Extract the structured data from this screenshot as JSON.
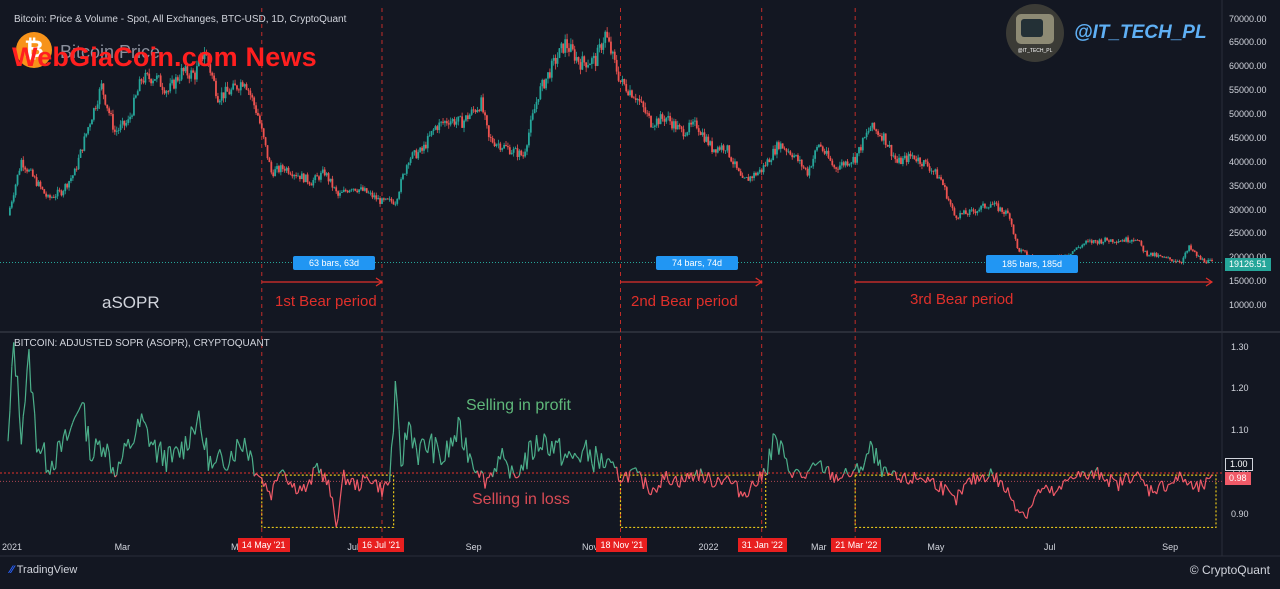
{
  "header": {
    "price_title": "Bitcoin: Price & Volume - Spot, All Exchanges, BTC-USD, 1D, CryptoQuant",
    "sopr_title": "BITCOIN: ADJUSTED SOPR (ASOPR), CRYPTOQUANT",
    "ghost_label": "Bitcoin Price",
    "watermark": "WebGiaCoin.com News",
    "handle": "@IT_TECH_PL",
    "avatar_caption": "@IT_TECH_PL"
  },
  "footer": {
    "tradingview": "TradingView",
    "cryptoquant": "CryptoQuant"
  },
  "annotations": {
    "asopr": "aSOPR",
    "bear1": "1st Bear period",
    "bear2": "2nd Bear period",
    "bear3": "3rd Bear period",
    "profit": "Selling in profit",
    "loss": "Selling in loss",
    "badge1": "63 bars, 63d",
    "badge2": "74 bars, 74d",
    "badge3": "185 bars, 185d"
  },
  "colors": {
    "background": "#131722",
    "up": "#26a69a",
    "down": "#ef5350",
    "profit_line": "#4caf8a",
    "loss_line": "#f05a68",
    "annotation_red": "#e0302b",
    "highlight_box": "#e6c619"
  },
  "chart_data": [
    {
      "type": "candlestick",
      "title": "Bitcoin: Price & Volume - Spot, All Exchanges, BTC-USD, 1D, CryptoQuant",
      "ylim": [
        5000,
        72000
      ],
      "y_ticks": [
        "70000.00",
        "65000.00",
        "60000.00",
        "55000.00",
        "50000.00",
        "45000.00",
        "40000.00",
        "35000.00",
        "30000.00",
        "25000.00",
        "20000.00",
        "15000.00",
        "10000.00"
      ],
      "last_price": "19126.51",
      "x_ticks": [
        "2021",
        "Mar",
        "May",
        "Jul",
        "Sep",
        "Nov",
        "2022",
        "Mar",
        "May",
        "Jul",
        "Sep"
      ],
      "series": [
        {
          "points": [
            [
              "2021-01-01",
              29000
            ],
            [
              "2021-01-08",
              40500
            ],
            [
              "2021-01-15",
              36500
            ],
            [
              "2021-01-22",
              32500
            ],
            [
              "2021-01-29",
              34000
            ],
            [
              "2021-02-05",
              38000
            ],
            [
              "2021-02-12",
              47500
            ],
            [
              "2021-02-19",
              56000
            ],
            [
              "2021-02-26",
              46500
            ],
            [
              "2021-03-05",
              48500
            ],
            [
              "2021-03-12",
              57500
            ],
            [
              "2021-03-19",
              58000
            ],
            [
              "2021-03-26",
              55000
            ],
            [
              "2021-04-02",
              59000
            ],
            [
              "2021-04-09",
              58500
            ],
            [
              "2021-04-14",
              63500
            ],
            [
              "2021-04-21",
              54000
            ],
            [
              "2021-04-28",
              55000
            ],
            [
              "2021-05-05",
              57500
            ],
            [
              "2021-05-12",
              50000
            ],
            [
              "2021-05-19",
              38000
            ],
            [
              "2021-05-26",
              39000
            ],
            [
              "2021-06-02",
              37500
            ],
            [
              "2021-06-09",
              36000
            ],
            [
              "2021-06-16",
              38000
            ],
            [
              "2021-06-23",
              33000
            ],
            [
              "2021-06-30",
              35000
            ],
            [
              "2021-07-07",
              34000
            ],
            [
              "2021-07-16",
              31800
            ],
            [
              "2021-07-23",
              32000
            ],
            [
              "2021-07-30",
              41000
            ],
            [
              "2021-08-06",
              42500
            ],
            [
              "2021-08-13",
              47500
            ],
            [
              "2021-08-20",
              49000
            ],
            [
              "2021-08-27",
              48500
            ],
            [
              "2021-09-06",
              52500
            ],
            [
              "2021-09-10",
              45000
            ],
            [
              "2021-09-20",
              43000
            ],
            [
              "2021-09-28",
              41500
            ],
            [
              "2021-10-06",
              54500
            ],
            [
              "2021-10-15",
              61500
            ],
            [
              "2021-10-20",
              65000
            ],
            [
              "2021-10-28",
              61000
            ],
            [
              "2021-11-05",
              61500
            ],
            [
              "2021-11-10",
              67000
            ],
            [
              "2021-11-18",
              57000
            ],
            [
              "2021-11-26",
              54000
            ],
            [
              "2021-12-04",
              48500
            ],
            [
              "2021-12-12",
              49500
            ],
            [
              "2021-12-20",
              46500
            ],
            [
              "2021-12-28",
              48000
            ],
            [
              "2022-01-05",
              43000
            ],
            [
              "2022-01-12",
              43500
            ],
            [
              "2022-01-21",
              36000
            ],
            [
              "2022-01-31",
              38500
            ],
            [
              "2022-02-09",
              44000
            ],
            [
              "2022-02-16",
              42000
            ],
            [
              "2022-02-24",
              38000
            ],
            [
              "2022-03-02",
              44000
            ],
            [
              "2022-03-10",
              39000
            ],
            [
              "2022-03-21",
              41000
            ],
            [
              "2022-03-29",
              47500
            ],
            [
              "2022-04-05",
              45500
            ],
            [
              "2022-04-12",
              40000
            ],
            [
              "2022-04-20",
              41500
            ],
            [
              "2022-04-28",
              39500
            ],
            [
              "2022-05-05",
              36500
            ],
            [
              "2022-05-12",
              29000
            ],
            [
              "2022-05-20",
              29500
            ],
            [
              "2022-05-31",
              31500
            ],
            [
              "2022-06-10",
              29000
            ],
            [
              "2022-06-14",
              22000
            ],
            [
              "2022-06-20",
              20500
            ],
            [
              "2022-06-30",
              19500
            ],
            [
              "2022-07-10",
              20800
            ],
            [
              "2022-07-20",
              23300
            ],
            [
              "2022-07-30",
              23800
            ],
            [
              "2022-08-10",
              23900
            ],
            [
              "2022-08-15",
              24300
            ],
            [
              "2022-08-20",
              21200
            ],
            [
              "2022-08-30",
              20000
            ],
            [
              "2022-09-08",
              19400
            ],
            [
              "2022-09-12",
              22200
            ],
            [
              "2022-09-18",
              19800
            ],
            [
              "2022-09-24",
              19126.51
            ]
          ]
        }
      ],
      "markers": [
        {
          "date": "14 May '21"
        },
        {
          "date": "16 Jul '21"
        },
        {
          "date": "18 Nov '21"
        },
        {
          "date": "31 Jan '22"
        },
        {
          "date": "21 Mar '22"
        }
      ]
    },
    {
      "type": "line",
      "title": "BITCOIN: ADJUSTED SOPR (ASOPR), CRYPTOQUANT",
      "ylim": [
        0.84,
        1.33
      ],
      "y_ticks": [
        "1.30",
        "1.20",
        "1.10",
        "1.00",
        "0.90"
      ],
      "reference_value": "1.00",
      "last_value": "0.98",
      "series": [
        {
          "points": [
            [
              "2021-01-01",
              1.06
            ],
            [
              "2021-01-04",
              1.31
            ],
            [
              "2021-01-08",
              1.1
            ],
            [
              "2021-01-12",
              1.27
            ],
            [
              "2021-01-16",
              1.08
            ],
            [
              "2021-01-22",
              1.02
            ],
            [
              "2021-01-28",
              1.05
            ],
            [
              "2021-02-03",
              1.1
            ],
            [
              "2021-02-08",
              1.18
            ],
            [
              "2021-02-14",
              1.04
            ],
            [
              "2021-02-20",
              1.08
            ],
            [
              "2021-02-26",
              1.0
            ],
            [
              "2021-03-05",
              1.06
            ],
            [
              "2021-03-12",
              1.12
            ],
            [
              "2021-03-20",
              1.05
            ],
            [
              "2021-03-28",
              1.03
            ],
            [
              "2021-04-04",
              1.07
            ],
            [
              "2021-04-10",
              1.13
            ],
            [
              "2021-04-18",
              1.01
            ],
            [
              "2021-04-26",
              1.04
            ],
            [
              "2021-05-05",
              1.08
            ],
            [
              "2021-05-12",
              1.0
            ],
            [
              "2021-05-19",
              0.95
            ],
            [
              "2021-05-24",
              1.02
            ],
            [
              "2021-05-30",
              0.97
            ],
            [
              "2021-06-07",
              0.96
            ],
            [
              "2021-06-12",
              1.02
            ],
            [
              "2021-06-18",
              0.97
            ],
            [
              "2021-06-22",
              0.88
            ],
            [
              "2021-06-26",
              0.99
            ],
            [
              "2021-07-03",
              0.97
            ],
            [
              "2021-07-10",
              0.99
            ],
            [
              "2021-07-16",
              0.96
            ],
            [
              "2021-07-20",
              0.98
            ],
            [
              "2021-07-23",
              1.19
            ],
            [
              "2021-07-26",
              1.02
            ],
            [
              "2021-07-30",
              1.12
            ],
            [
              "2021-08-04",
              1.05
            ],
            [
              "2021-08-10",
              1.07
            ],
            [
              "2021-08-17",
              1.03
            ],
            [
              "2021-08-25",
              1.1
            ],
            [
              "2021-09-01",
              1.04
            ],
            [
              "2021-09-08",
              0.98
            ],
            [
              "2021-09-16",
              1.03
            ],
            [
              "2021-09-24",
              0.99
            ],
            [
              "2021-10-02",
              1.05
            ],
            [
              "2021-10-08",
              1.08
            ],
            [
              "2021-10-15",
              1.06
            ],
            [
              "2021-10-22",
              1.03
            ],
            [
              "2021-10-30",
              1.05
            ],
            [
              "2021-11-06",
              1.03
            ],
            [
              "2021-11-12",
              1.02
            ],
            [
              "2021-11-18",
              0.99
            ],
            [
              "2021-11-25",
              1.0
            ],
            [
              "2021-12-04",
              0.96
            ],
            [
              "2021-12-12",
              0.99
            ],
            [
              "2021-12-20",
              0.98
            ],
            [
              "2021-12-28",
              1.0
            ],
            [
              "2022-01-05",
              0.98
            ],
            [
              "2022-01-12",
              0.99
            ],
            [
              "2022-01-21",
              0.95
            ],
            [
              "2022-01-31",
              0.99
            ],
            [
              "2022-02-07",
              1.08
            ],
            [
              "2022-02-14",
              1.01
            ],
            [
              "2022-02-22",
              0.99
            ],
            [
              "2022-03-02",
              1.02
            ],
            [
              "2022-03-10",
              0.99
            ],
            [
              "2022-03-21",
              1.0
            ],
            [
              "2022-03-29",
              1.05
            ],
            [
              "2022-04-05",
              1.0
            ],
            [
              "2022-04-14",
              0.98
            ],
            [
              "2022-04-25",
              0.99
            ],
            [
              "2022-05-05",
              0.97
            ],
            [
              "2022-05-12",
              0.93
            ],
            [
              "2022-05-20",
              0.98
            ],
            [
              "2022-05-31",
              1.0
            ],
            [
              "2022-06-08",
              0.96
            ],
            [
              "2022-06-14",
              0.92
            ],
            [
              "2022-06-18",
              0.9
            ],
            [
              "2022-06-26",
              0.96
            ],
            [
              "2022-07-05",
              0.95
            ],
            [
              "2022-07-13",
              1.0
            ],
            [
              "2022-07-20",
              0.99
            ],
            [
              "2022-07-28",
              1.0
            ],
            [
              "2022-08-05",
              0.97
            ],
            [
              "2022-08-14",
              1.0
            ],
            [
              "2022-08-22",
              0.96
            ],
            [
              "2022-08-30",
              0.97
            ],
            [
              "2022-09-08",
              0.99
            ],
            [
              "2022-09-15",
              0.96
            ],
            [
              "2022-09-24",
              0.98
            ]
          ]
        }
      ]
    }
  ]
}
